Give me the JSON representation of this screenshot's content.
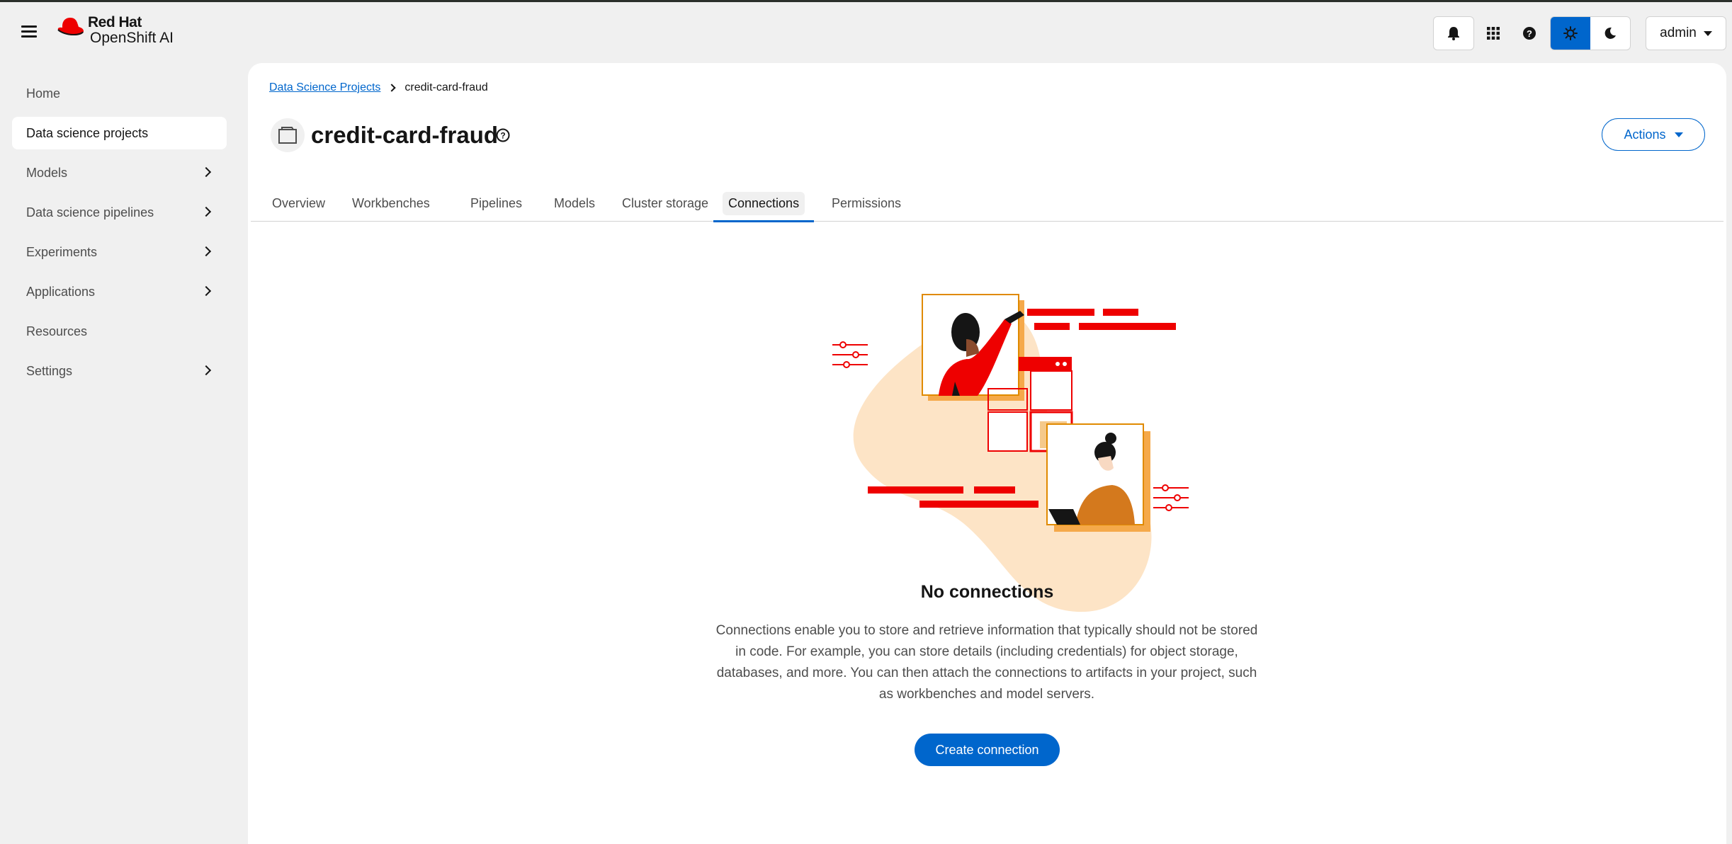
{
  "masthead": {
    "brand": "Red Hat",
    "product": "OpenShift AI",
    "user": "admin",
    "icons": [
      "menu-icon",
      "bell-icon",
      "app-grid-icon",
      "help-icon",
      "sun-icon",
      "moon-icon"
    ]
  },
  "sidebar": {
    "items": [
      {
        "label": "Home",
        "expandable": false,
        "active": false
      },
      {
        "label": "Data science projects",
        "expandable": false,
        "active": true
      },
      {
        "label": "Models",
        "expandable": true,
        "active": false
      },
      {
        "label": "Data science pipelines",
        "expandable": true,
        "active": false
      },
      {
        "label": "Experiments",
        "expandable": true,
        "active": false
      },
      {
        "label": "Applications",
        "expandable": true,
        "active": false
      },
      {
        "label": "Resources",
        "expandable": false,
        "active": false
      },
      {
        "label": "Settings",
        "expandable": true,
        "active": false
      }
    ]
  },
  "breadcrumb": {
    "parent": "Data Science Projects",
    "current": "credit-card-fraud"
  },
  "page": {
    "title": "credit-card-fraud",
    "actions_label": "Actions"
  },
  "tabs": [
    {
      "label": "Overview",
      "active": false
    },
    {
      "label": "Workbenches",
      "active": false
    },
    {
      "label": "Pipelines",
      "active": false
    },
    {
      "label": "Models",
      "active": false
    },
    {
      "label": "Cluster storage",
      "active": false
    },
    {
      "label": "Connections",
      "active": true
    },
    {
      "label": "Permissions",
      "active": false
    }
  ],
  "empty_state": {
    "title": "No connections",
    "body": "Connections enable you to store and retrieve information that typically should not be stored in code. For example, you can store details (including credentials) for object storage, databases, and more. You can then attach the connections to artifacts in your project, such as workbenches and model servers.",
    "button": "Create connection"
  },
  "colors": {
    "accent": "#0066cc",
    "brand_red": "#ee0000",
    "illustration_peach": "#fde4c6",
    "illustration_orange": "#f5a94a"
  }
}
